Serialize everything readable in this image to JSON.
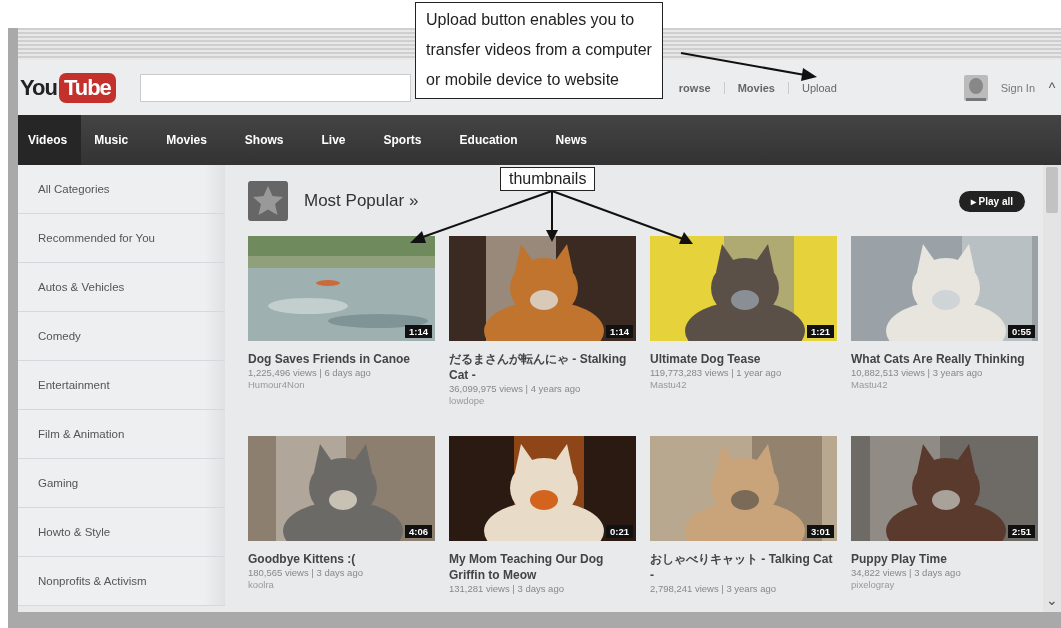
{
  "callouts": [
    {
      "lines": [
        "Upload button enables you to",
        "transfer videos from a computer",
        "or mobile device to website"
      ]
    },
    {
      "lines": [
        "thumbnails"
      ]
    }
  ],
  "header": {
    "logo": {
      "first": "You",
      "second": "Tube"
    },
    "links": [
      "rowse",
      "Movies",
      "Upload"
    ],
    "sign_in": "Sign In",
    "scroll_up": "^"
  },
  "nav": [
    {
      "label": "Videos",
      "selected": true
    },
    {
      "label": "Music",
      "selected": false
    },
    {
      "label": "Movies",
      "selected": false
    },
    {
      "label": "Shows",
      "selected": false
    },
    {
      "label": "Live",
      "selected": false
    },
    {
      "label": "Sports",
      "selected": false
    },
    {
      "label": "Education",
      "selected": false
    },
    {
      "label": "News",
      "selected": false
    }
  ],
  "sidebar": {
    "items": [
      "All Categories",
      "Recommended for You",
      "Autos & Vehicles",
      "Comedy",
      "Entertainment",
      "Film & Animation",
      "Gaming",
      "Howto & Style",
      "Nonprofits & Activism"
    ]
  },
  "section": {
    "title": "Most Popular »",
    "play_all": "▸ Play all"
  },
  "videos": [
    {
      "duration": "1:14",
      "title": "Dog Saves Friends in Canoe",
      "views": "1,225,496 views | 6 days ago",
      "channel": "Humour4Non"
    },
    {
      "duration": "1:14",
      "title": "だるまさんが転んにゃ - Stalking Cat -",
      "views": "36,099,975 views | 4 years ago",
      "channel": "lowdope"
    },
    {
      "duration": "1:21",
      "title": "Ultimate Dog Tease",
      "views": "119,773,283 views | 1 year ago",
      "channel": "Mastu42"
    },
    {
      "duration": "0:55",
      "title": "What Cats Are Really Thinking",
      "views": "10,882,513 views | 3 years ago",
      "channel": "Mastu42"
    },
    {
      "duration": "4:06",
      "title": "Goodbye Kittens :(",
      "views": "180,565 views | 3 days ago",
      "channel": "koolra"
    },
    {
      "duration": "0:21",
      "title": "My Mom Teaching Our Dog Griffin to Meow",
      "views": "131,281 views | 3 days ago"
    },
    {
      "duration": "3:01",
      "title": "おしゃべりキャット - Talking Cat -",
      "views": "2,798,241 views | 3 years ago"
    },
    {
      "duration": "2:51",
      "title": "Puppy Play Time",
      "views": "34,822 views | 3 days ago",
      "channel": "pixelogray"
    }
  ],
  "scroll_down": "⌄"
}
